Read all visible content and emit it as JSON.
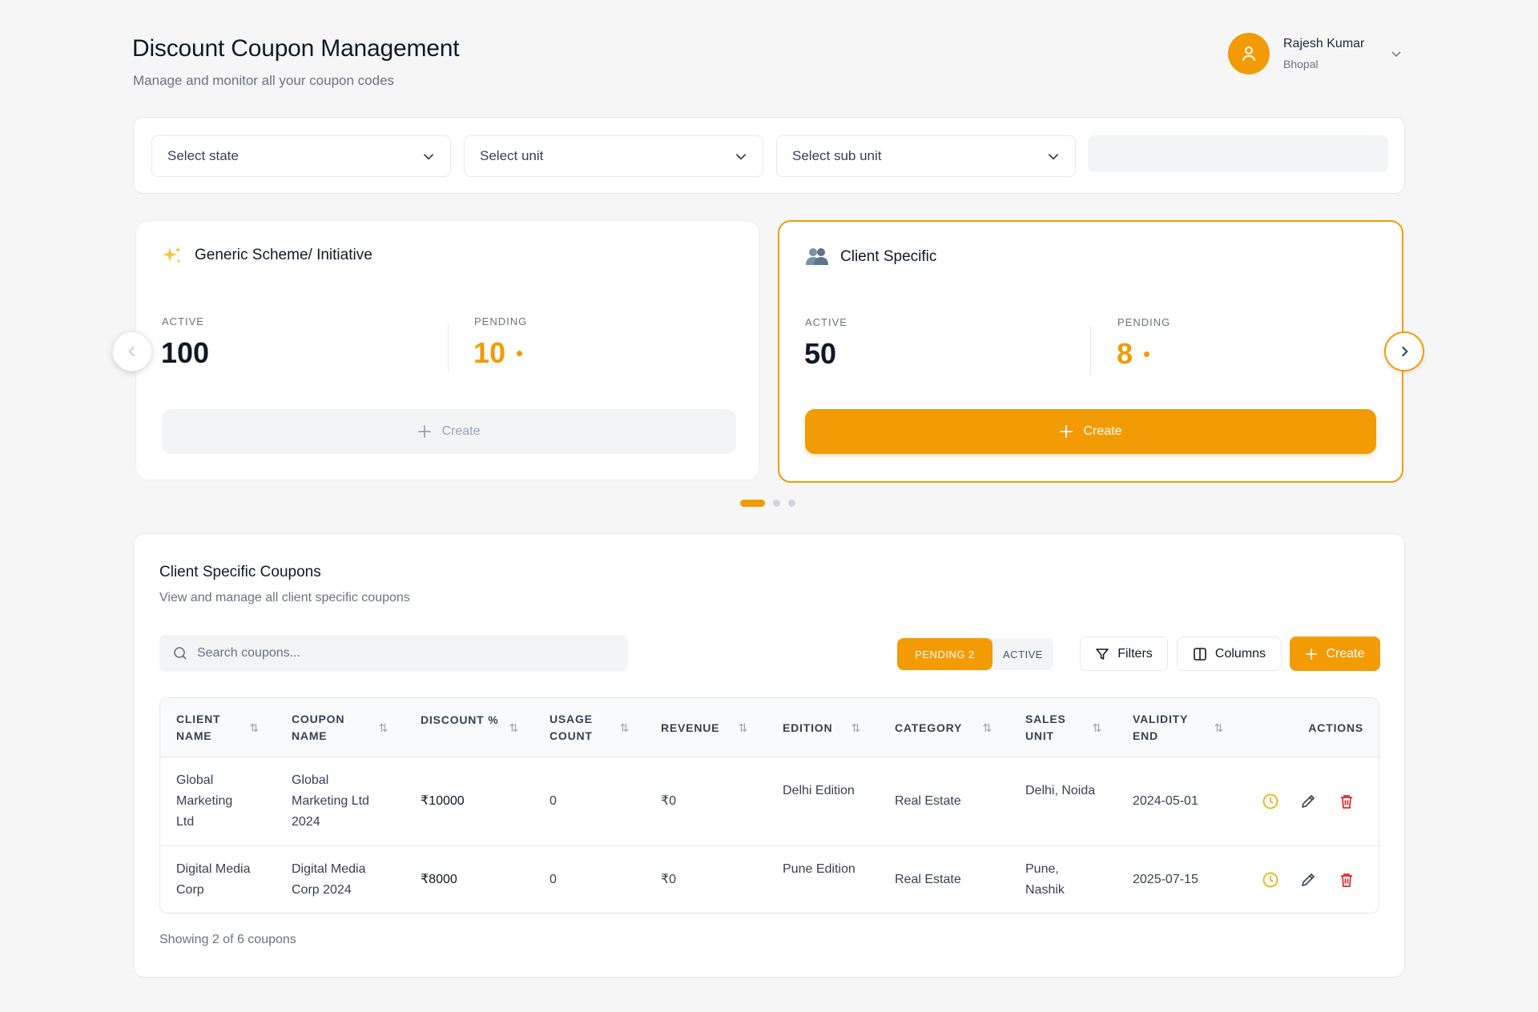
{
  "header": {
    "title": "Discount Coupon Management",
    "subtitle": "Manage and monitor all your coupon codes"
  },
  "user": {
    "name": "Rajesh Kumar",
    "location": "Bhopal",
    "avatar_icon": "user-icon"
  },
  "filters": {
    "state_placeholder": "Select state",
    "unit_placeholder": "Select unit",
    "sub_unit_placeholder": "Select sub unit"
  },
  "cards": [
    {
      "icon": "sparkles-icon",
      "title": "Generic Scheme/ Initiative",
      "active_label": "ACTIVE",
      "active_value": "100",
      "pending_label": "PENDING",
      "pending_value": "10",
      "create_label": "Create",
      "selected": false
    },
    {
      "icon": "users-icon",
      "title": "Client Specific",
      "active_label": "ACTIVE",
      "active_value": "50",
      "pending_label": "PENDING",
      "pending_value": "8",
      "create_label": "Create",
      "selected": true
    }
  ],
  "carousel": {
    "pages": 3,
    "current": 1
  },
  "coupons": {
    "title": "Client Specific Coupons",
    "subtitle": "View and manage all client specific coupons",
    "search_placeholder": "Search coupons...",
    "tab_pending": "PENDING 2",
    "tab_active": "ACTIVE",
    "filters_label": "Filters",
    "columns_label": "Columns",
    "create_label": "Create",
    "columns": [
      {
        "l1": "CLIENT",
        "l2": "NAME"
      },
      {
        "l1": "COUPON",
        "l2": "NAME"
      },
      {
        "l1": "DISCOUNT %",
        "l2": ""
      },
      {
        "l1": "USAGE",
        "l2": "COUNT"
      },
      {
        "l1": "REVENUE",
        "l2": ""
      },
      {
        "l1": "EDITION",
        "l2": ""
      },
      {
        "l1": "CATEGORY",
        "l2": ""
      },
      {
        "l1": "SALES",
        "l2": "UNIT"
      },
      {
        "l1": "VALIDITY",
        "l2": "END"
      },
      {
        "l1": "ACTIONS",
        "l2": ""
      }
    ],
    "rows": [
      {
        "client_l1": "Global",
        "client_l2": "Marketing",
        "client_l3": "Ltd",
        "coupon_l1": "Global",
        "coupon_l2": "Marketing Ltd",
        "coupon_l3": "2024",
        "discount": "₹10000",
        "usage": "0",
        "revenue": "₹0",
        "edition": "Delhi Edition",
        "category": "Real Estate",
        "sales_l1": "Delhi, Noida",
        "sales_l2": "",
        "validity": "2024-05-01"
      },
      {
        "client_l1": "Digital Media",
        "client_l2": "Corp",
        "client_l3": "",
        "coupon_l1": "Digital Media",
        "coupon_l2": "Corp 2024",
        "coupon_l3": "",
        "discount": "₹8000",
        "usage": "0",
        "revenue": "₹0",
        "edition": "Pune Edition",
        "category": "Real Estate",
        "sales_l1": "Pune,",
        "sales_l2": "Nashik",
        "validity": "2025-07-15"
      }
    ],
    "footer": "Showing 2 of 6 coupons"
  },
  "colors": {
    "accent": "#f29b05",
    "danger": "#dc2626",
    "background": "#f6f6f6"
  }
}
